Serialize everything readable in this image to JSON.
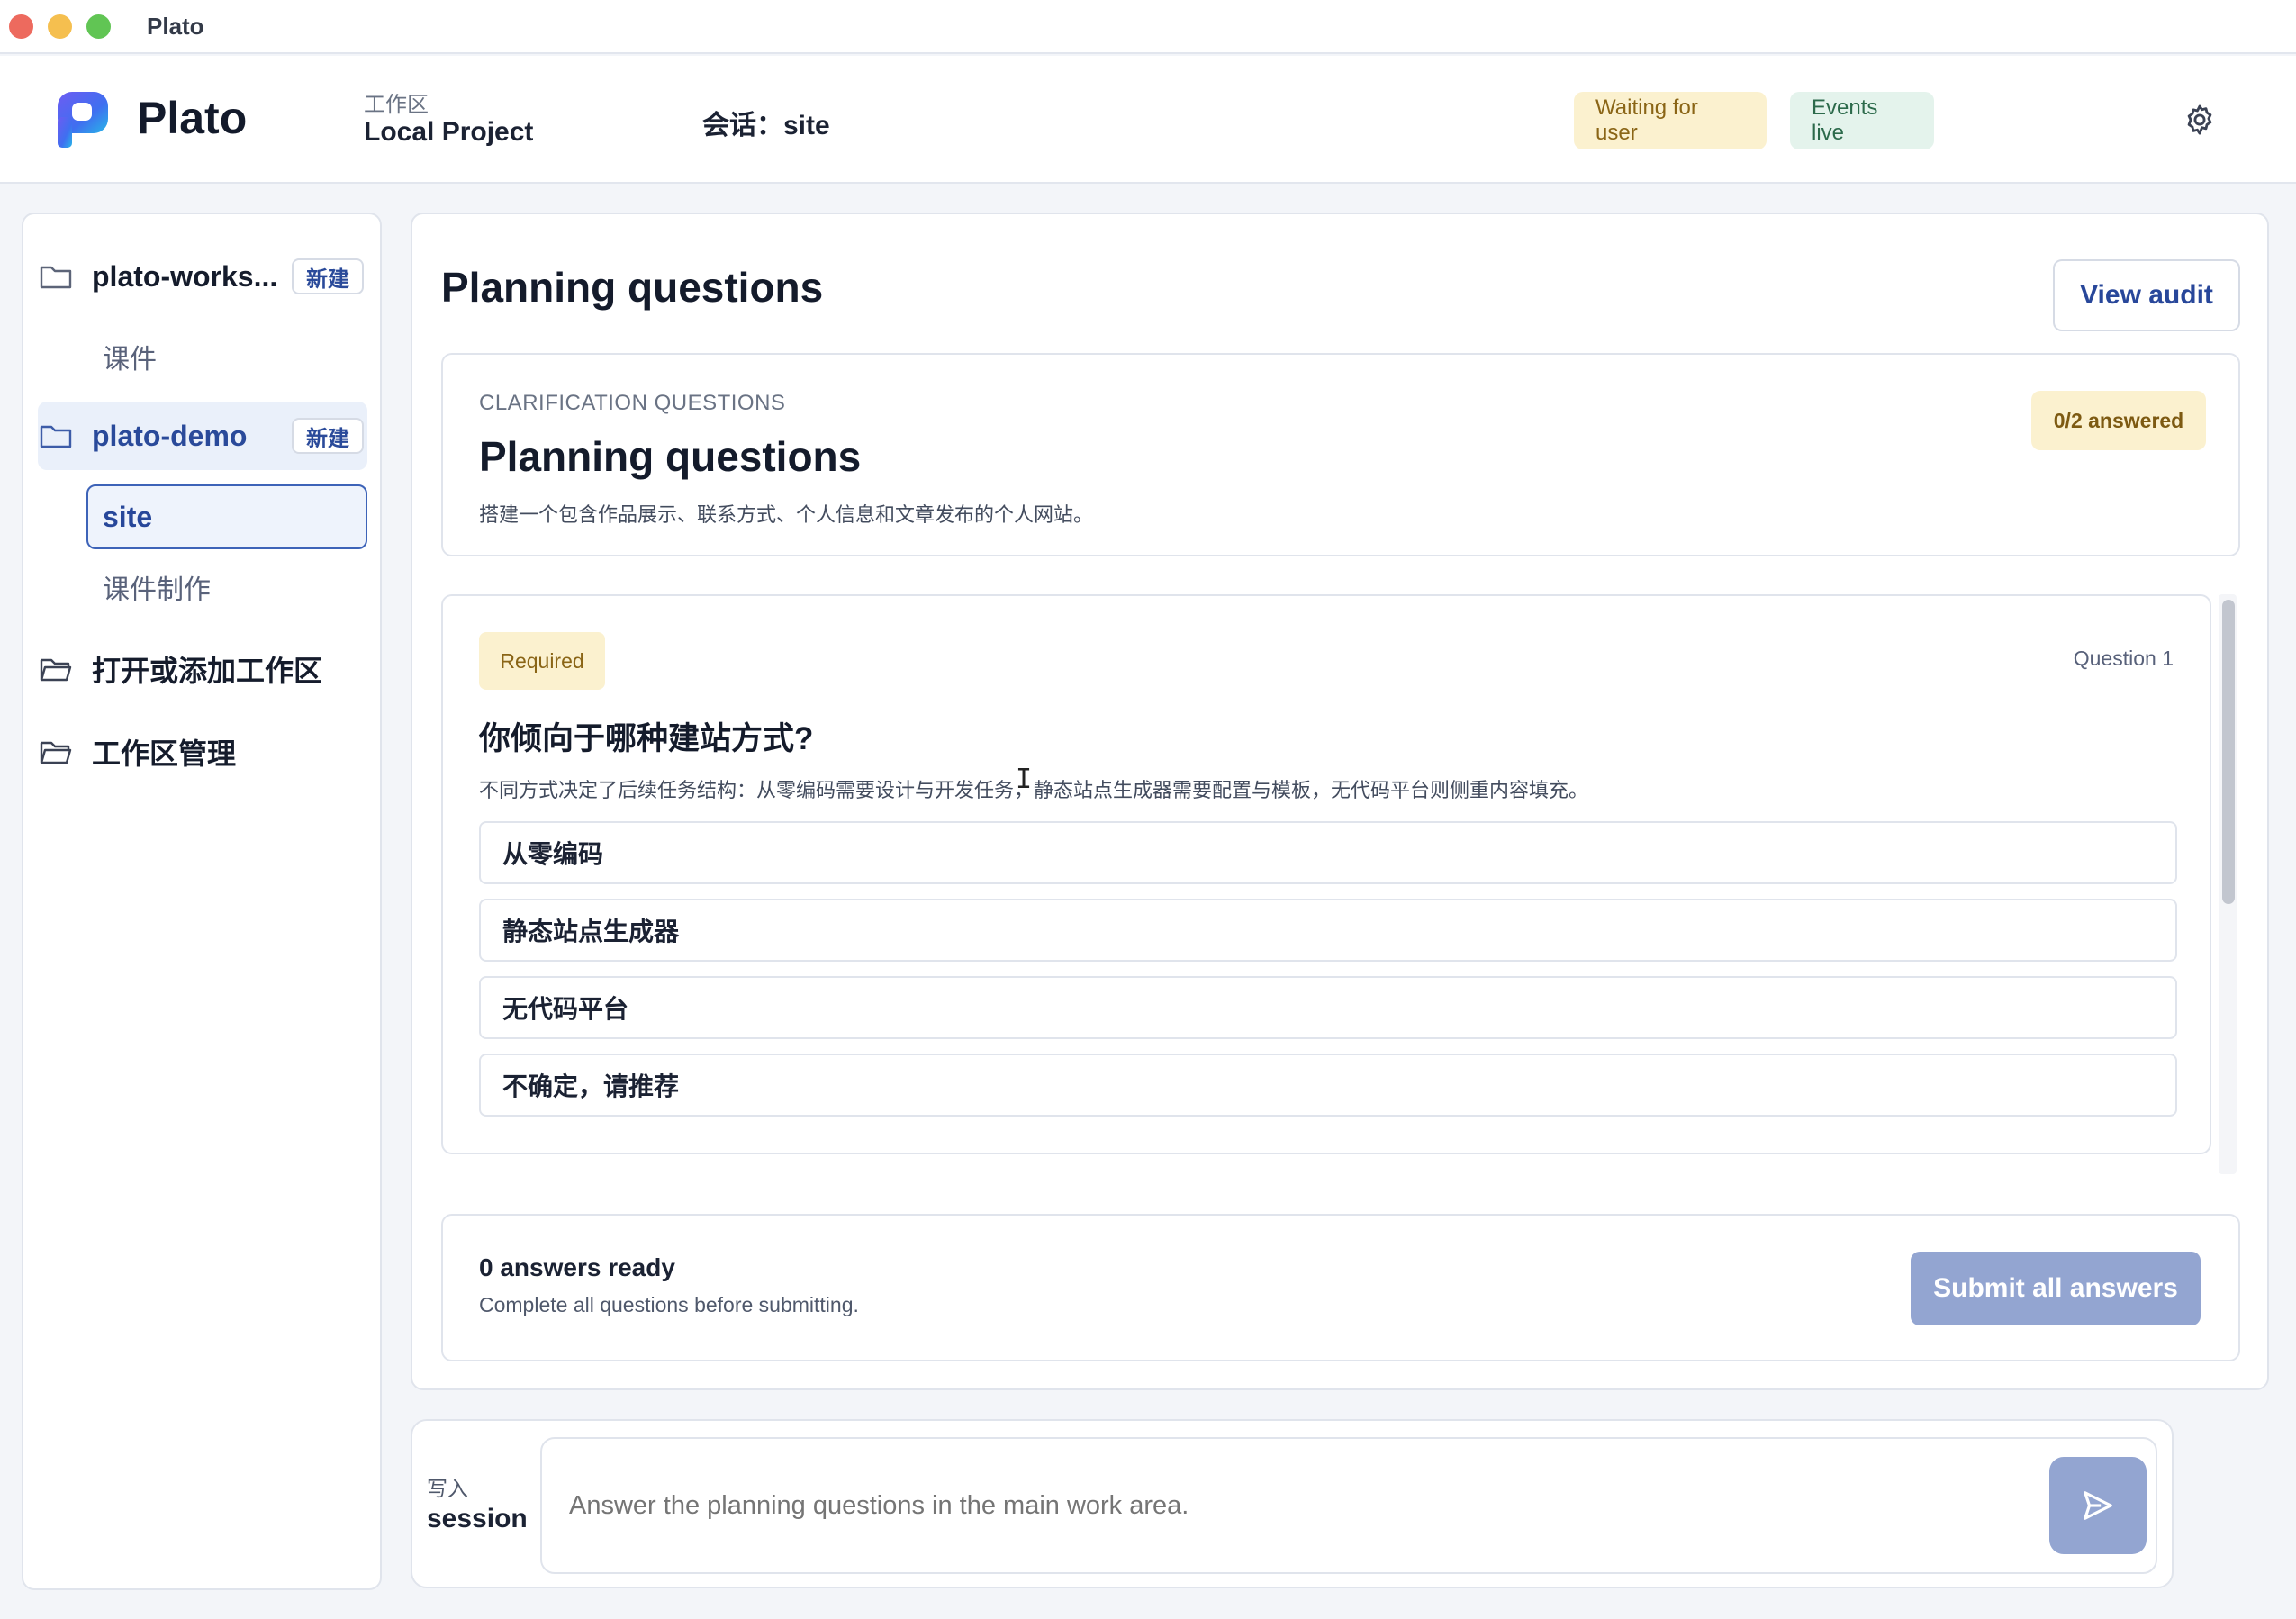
{
  "window": {
    "title": "Plato"
  },
  "header": {
    "brand": "Plato",
    "workspace_caption": "工作区",
    "workspace_name": "Local Project",
    "session_label": "会话：site",
    "status_waiting": "Waiting for user",
    "status_events": "Events live"
  },
  "sidebar": {
    "workspaces": [
      {
        "name": "plato-works...",
        "new_label": "新建",
        "children": [
          "课件"
        ]
      },
      {
        "name": "plato-demo",
        "new_label": "新建",
        "children": [
          "site",
          "课件制作"
        ],
        "selected_child": "site"
      }
    ],
    "actions": [
      {
        "label": "打开或添加工作区"
      },
      {
        "label": "工作区管理"
      }
    ]
  },
  "main": {
    "title": "Planning questions",
    "audit_label": "View audit",
    "clarification": {
      "caption": "CLARIFICATION QUESTIONS",
      "title": "Planning questions",
      "description": "搭建一个包含作品展示、联系方式、个人信息和文章发布的个人网站。",
      "answered": "0/2 answered"
    },
    "question": {
      "badge": "Required",
      "number": "Question 1",
      "title": "你倾向于哪种建站方式?",
      "description": "不同方式决定了后续任务结构：从零编码需要设计与开发任务，静态站点生成器需要配置与模板，无代码平台则侧重内容填充。",
      "options": [
        "从零编码",
        "静态站点生成器",
        "无代码平台",
        "不确定，请推荐"
      ]
    },
    "submit": {
      "ready": "0 answers ready",
      "hint": "Complete all questions before submitting.",
      "button": "Submit all answers"
    }
  },
  "composer": {
    "caption": "写入",
    "target": "session",
    "placeholder": "Answer the planning questions in the main work area."
  },
  "colors": {
    "accent": "#27479a",
    "submit_disabled": "#93a5d1",
    "warning_bg": "#fbf1cf",
    "live_bg": "#e4f3ec"
  }
}
